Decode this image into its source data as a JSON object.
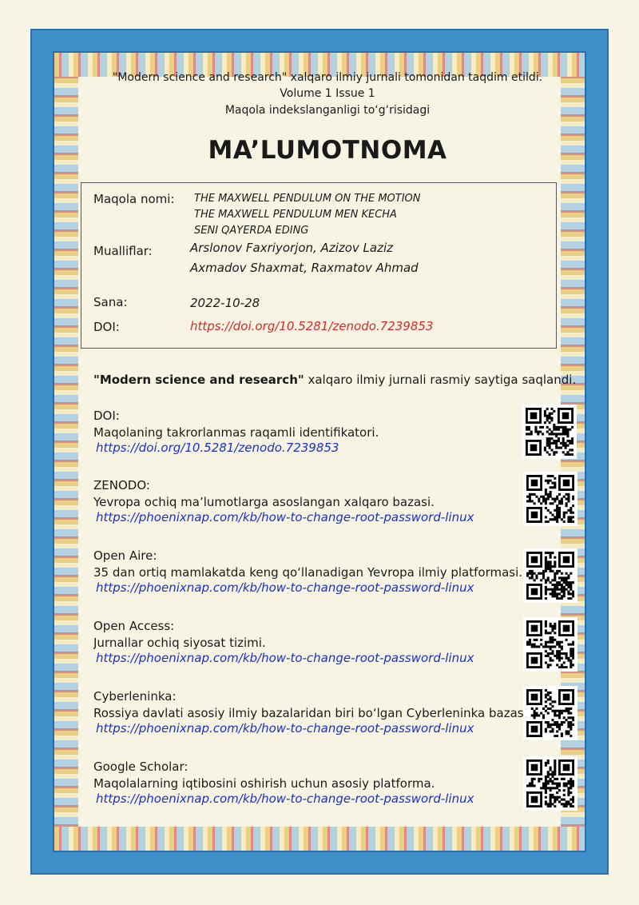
{
  "header": {
    "line1": "\"Modern science and research\" xalqaro ilmiy jurnali tomonidan taqdim etildi.",
    "line2": "Volume 1 Issue 1",
    "line3": "Maqola indekslanganligi to‘g‘risidagi",
    "title": "MA’LUMOTNOMA"
  },
  "info": {
    "title_label": "Maqola nomi:",
    "title_lines": [
      "THE MAXWELL PENDULUM ON THE MOTION",
      "THE MAXWELL PENDULUM MEN KECHA",
      "SENI QAYERDA EDING"
    ],
    "authors_label": "Mualliflar:",
    "authors_lines": [
      "Arslonov Faxriyorjon, Azizov Laziz",
      "Axmadov Shaxmat, Raxmatov Ahmad"
    ],
    "date_label": "Sana:",
    "date": "2022-10-28",
    "doi_label": "DOI:",
    "doi": "https://doi.org/10.5281/zenodo.7239853"
  },
  "saved_line": {
    "bold": "\"Modern science and research\"",
    "rest": " xalqaro ilmiy jurnali rasmiy saytiga saqlandi."
  },
  "sections": [
    {
      "title": "DOI:",
      "desc": "Maqolaning takrorlanmas raqamli identifikatori.",
      "link": "https://doi.org/10.5281/zenodo.7239853"
    },
    {
      "title": "ZENODO:",
      "desc": "Yevropa ochiq ma’lumotlarga asoslangan xalqaro bazasi.",
      "link": "https://phoenixnap.com/kb/how-to-change-root-password-linux"
    },
    {
      "title": "Open Aire:",
      "desc": "35 dan ortiq mamlakatda keng qo‘llanadigan Yevropa ilmiy platformasi.",
      "link": "https://phoenixnap.com/kb/how-to-change-root-password-linux"
    },
    {
      "title": "Open Access:",
      "desc": "Jurnallar ochiq siyosat tizimi.",
      "link": "https://phoenixnap.com/kb/how-to-change-root-password-linux"
    },
    {
      "title": "Cyberleninka:",
      "desc": "Rossiya davlati asosiy ilmiy bazalaridan biri bo‘lgan Cyberleninka bazasi.",
      "link": "https://phoenixnap.com/kb/how-to-change-root-password-linux"
    },
    {
      "title": "Google Scholar:",
      "desc": "Maqolalarning iqtibosini oshirish uchun asosiy platforma.",
      "link": "https://phoenixnap.com/kb/how-to-change-root-password-linux"
    }
  ],
  "colors": {
    "link": "#1a2fc8",
    "doi_red": "#d42a2a",
    "frame_blue": "#3f90c8"
  }
}
